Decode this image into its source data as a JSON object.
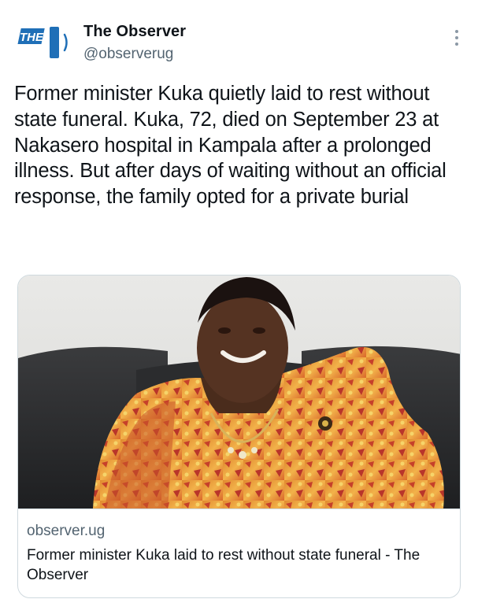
{
  "account": {
    "name": "The Observer",
    "handle": "@observerug",
    "logo_text": "THE"
  },
  "tweet": {
    "text": "Former minister Kuka quietly laid to rest without state funeral. Kuka, 72, died on September 23 at Nakasero hospital in Kampala after a prolonged illness. But after days of waiting without an official response, the family opted for a private burial"
  },
  "card": {
    "domain": "observer.ug",
    "title": "Former minister Kuka laid to rest without state funeral - The Observer"
  },
  "icons": {
    "more": "more-vertical-icon"
  },
  "colors": {
    "logo_blue": "#1f6fb7",
    "secondary_text": "#536471",
    "card_border": "#cfd9de"
  }
}
